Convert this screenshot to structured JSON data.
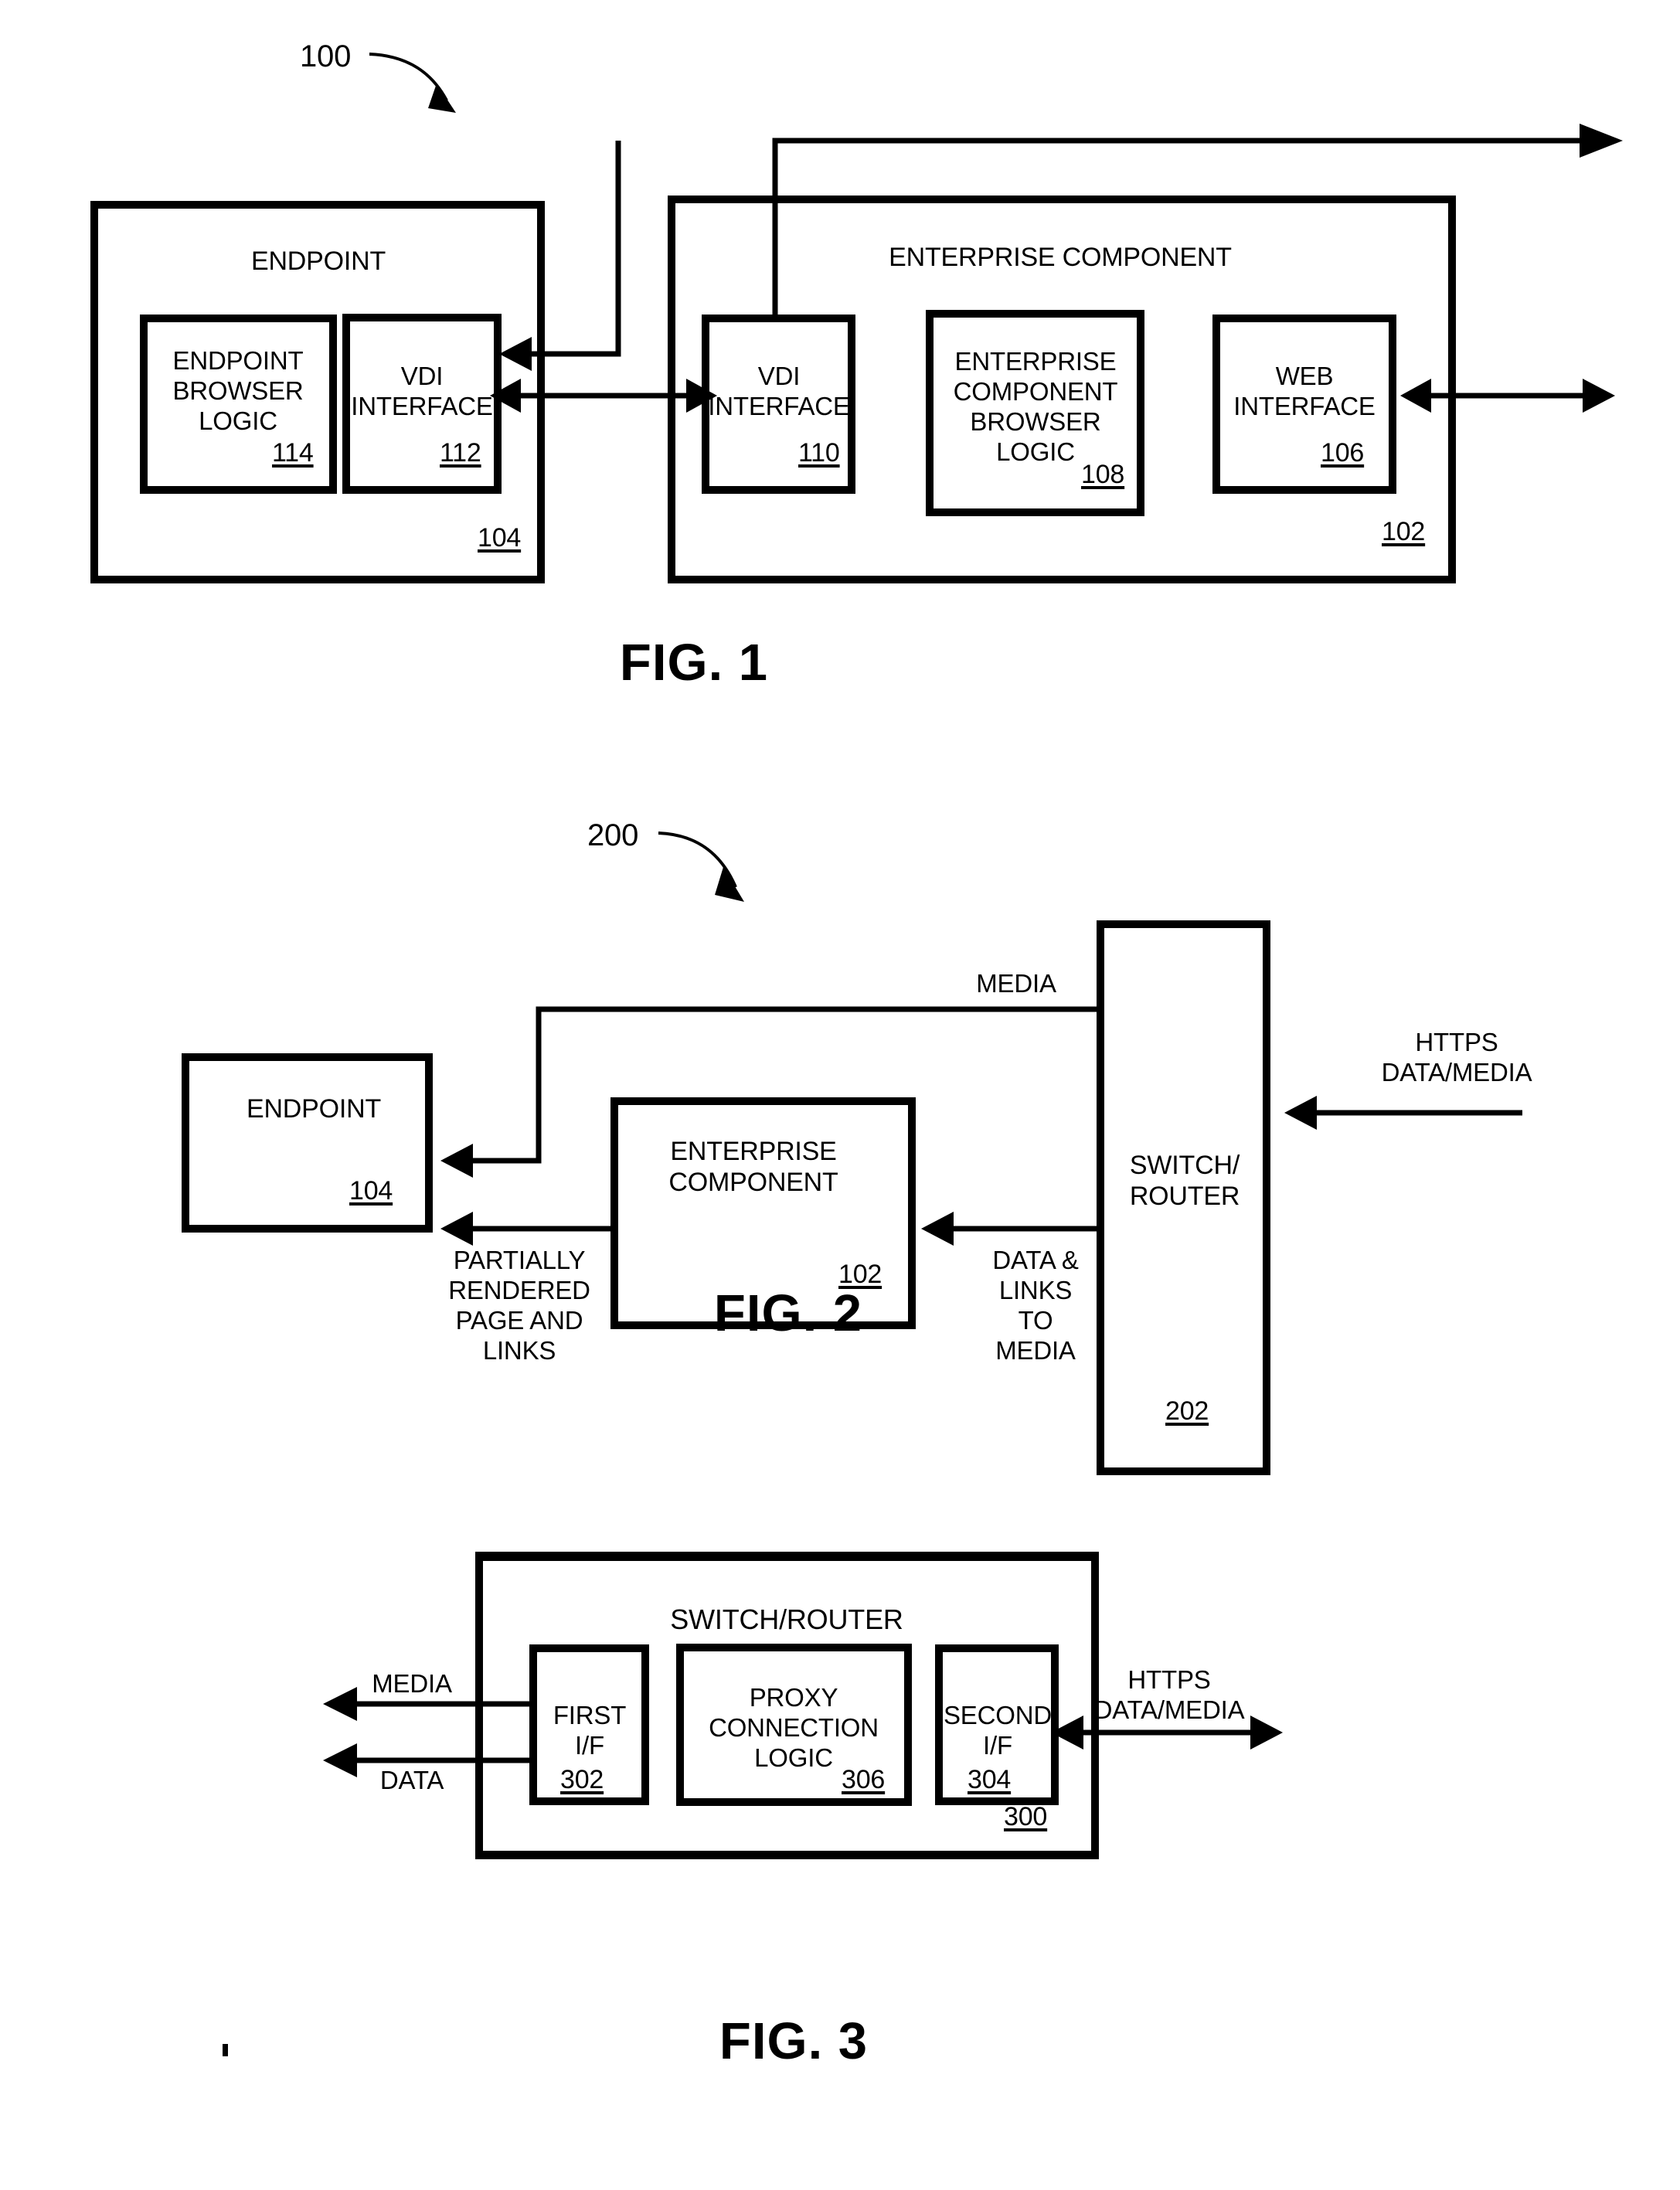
{
  "figures": [
    {
      "id": "fig1",
      "caption": "FIG. 1",
      "callout": "100",
      "blocks": [
        {
          "key": "endpoint",
          "title": "ENDPOINT",
          "ref": "104"
        },
        {
          "key": "enterprise",
          "title": "ENTERPRISE COMPONENT",
          "ref": "102"
        },
        {
          "key": "endpoint_browser",
          "title": "ENDPOINT\nBROWSER\nLOGIC",
          "ref": "114"
        },
        {
          "key": "vdi_endpoint",
          "title": "VDI\nINTERFACE",
          "ref": "112"
        },
        {
          "key": "vdi_enterprise",
          "title": "VDI\nINTERFACE",
          "ref": "110"
        },
        {
          "key": "ec_browser",
          "title": "ENTERPRISE\nCOMPONENT\nBROWSER\nLOGIC",
          "ref": "108"
        },
        {
          "key": "web_interface",
          "title": "WEB\nINTERFACE",
          "ref": "106"
        }
      ]
    },
    {
      "id": "fig2",
      "caption": "FIG. 2",
      "callout": "200",
      "blocks": [
        {
          "key": "endpoint",
          "title": "ENDPOINT",
          "ref": "104"
        },
        {
          "key": "enterprise",
          "title": "ENTERPRISE\nCOMPONENT",
          "ref": "102"
        },
        {
          "key": "switch",
          "title": "SWITCH/\nROUTER",
          "ref": "202"
        }
      ],
      "edge_labels": [
        {
          "key": "media",
          "text": "MEDIA"
        },
        {
          "key": "partial",
          "text": "PARTIALLY\nRENDERED\nPAGE AND\nLINKS"
        },
        {
          "key": "data_links",
          "text": "DATA &\nLINKS\nTO\nMEDIA"
        },
        {
          "key": "https",
          "text": "HTTPS\nDATA/MEDIA"
        }
      ]
    },
    {
      "id": "fig3",
      "caption": "FIG. 3",
      "blocks": [
        {
          "key": "switch_router",
          "title": "SWITCH/ROUTER",
          "ref": "300"
        },
        {
          "key": "first_if",
          "title": "FIRST\nI/F",
          "ref": "302"
        },
        {
          "key": "proxy_logic",
          "title": "PROXY\nCONNECTION\nLOGIC",
          "ref": "306"
        },
        {
          "key": "second_if",
          "title": "SECOND\nI/F",
          "ref": "304"
        }
      ],
      "edge_labels": [
        {
          "key": "media",
          "text": "MEDIA"
        },
        {
          "key": "data",
          "text": "DATA"
        },
        {
          "key": "https",
          "text": "HTTPS\nDATA/MEDIA"
        }
      ]
    }
  ]
}
